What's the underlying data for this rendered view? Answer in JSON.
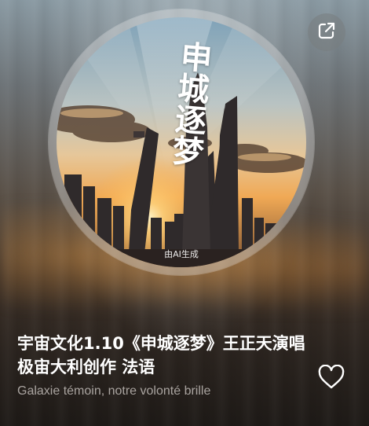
{
  "cover": {
    "title": "申城逐梦",
    "ai_badge": "由AI生成"
  },
  "song": {
    "title": "宇宙文化1.10《申城逐梦》王正天演唱 极宙大利创作 法语",
    "subtitle": "Galaxie témoin, notre volonté brille"
  },
  "icons": {
    "share": "share-external-icon",
    "like": "heart-outline-icon"
  },
  "colors": {
    "title_text": "#ffffff",
    "subtitle_text": "#c9c2bb",
    "share_button_bg": "#7a7e80"
  }
}
